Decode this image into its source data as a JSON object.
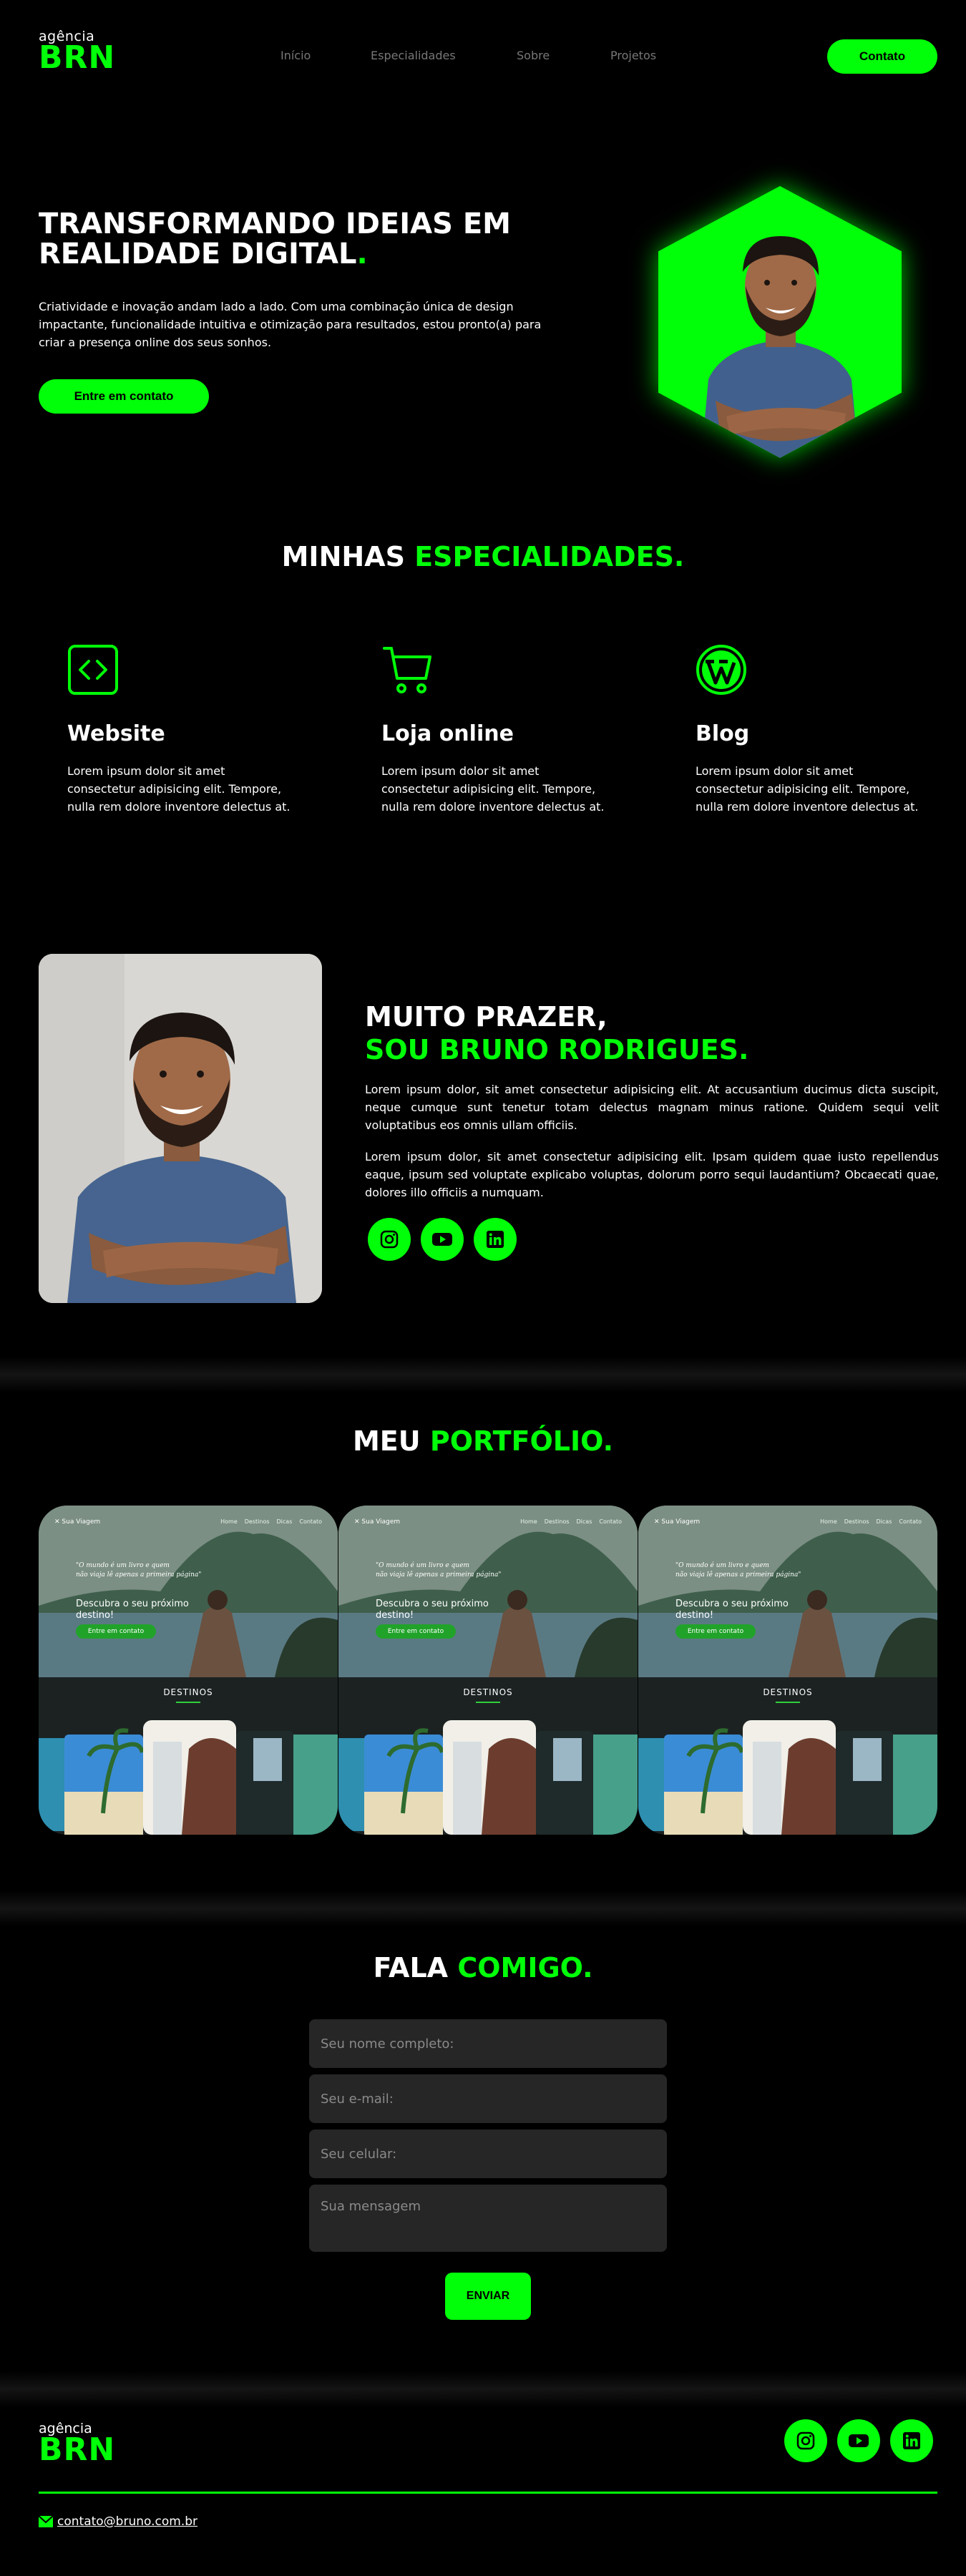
{
  "brand": {
    "small": "agência",
    "big": "BRN"
  },
  "nav": {
    "items": [
      "Início",
      "Especialidades",
      "Sobre",
      "Projetos"
    ],
    "cta": "Contato"
  },
  "hero": {
    "title_line1": "TRANSFORMANDO IDEIAS EM",
    "title_line2": "REALIDADE DIGITAL",
    "title_dot": ".",
    "text": "Criatividade e inovação andam lado a lado. Com uma combinação única de design impactante, funcionalidade intuitiva e otimização para resultados, estou pronto(a) para criar a presença online dos seus sonhos.",
    "button": "Entre em contato"
  },
  "specialties": {
    "title_white": "MINHAS",
    "title_green": "ESPECIALIDADES.",
    "items": [
      {
        "icon": "code-icon",
        "name": "Website",
        "text": "Lorem ipsum dolor sit amet consectetur adipisicing elit. Tempore, nulla rem dolore inventore delectus at."
      },
      {
        "icon": "cart-icon",
        "name": "Loja online",
        "text": "Lorem ipsum dolor sit amet consectetur adipisicing elit. Tempore, nulla rem dolore inventore delectus at."
      },
      {
        "icon": "wordpress-icon",
        "name": "Blog",
        "text": "Lorem ipsum dolor sit amet consectetur adipisicing elit. Tempore, nulla rem dolore inventore delectus at."
      }
    ]
  },
  "about": {
    "title_line1": "MUITO PRAZER,",
    "title_line2": "SOU BRUNO RODRIGUES.",
    "p1": "Lorem ipsum dolor, sit amet consectetur adipisicing elit. At accusantium ducimus dicta suscipit, neque cumque sunt tenetur totam delectus magnam minus ratione. Quidem sequi velit voluptatibus eos omnis ullam officiis.",
    "p2": "Lorem ipsum dolor, sit amet consectetur adipisicing elit. Ipsam quidem quae iusto repellendus eaque, ipsum sed voluptate explicabo voluptas, dolorum porro sequi laudantium? Obcaecati quae, dolores illo officiis a numquam.",
    "socials": [
      "instagram-icon",
      "youtube-icon",
      "linkedin-icon"
    ]
  },
  "portfolio": {
    "title_white": "MEU",
    "title_green": "PORTFÓLIO.",
    "card": {
      "site_name": "Sua Viagem",
      "menu": [
        "Home",
        "Destinos",
        "Dicas",
        "Contato"
      ],
      "quote_line1": "\"O mundo é um livro e quem",
      "quote_line2": "não viaja lê apenas a primeira página\"",
      "headline_line1": "Descubra o seu próximo",
      "headline_line2": "destino!",
      "cta": "Entre em contato",
      "section": "DESTINOS"
    }
  },
  "contact": {
    "title_white": "FALA",
    "title_green": "COMIGO.",
    "name_placeholder": "Seu nome completo:",
    "email_placeholder": "Seu e-mail:",
    "phone_placeholder": "Seu celular:",
    "message_placeholder": "Sua mensagem",
    "submit": "ENVIAR"
  },
  "footer": {
    "email": "contato@bruno.com.br"
  },
  "colors": {
    "accent": "#00ff08",
    "background": "#000000",
    "field": "#262626"
  }
}
